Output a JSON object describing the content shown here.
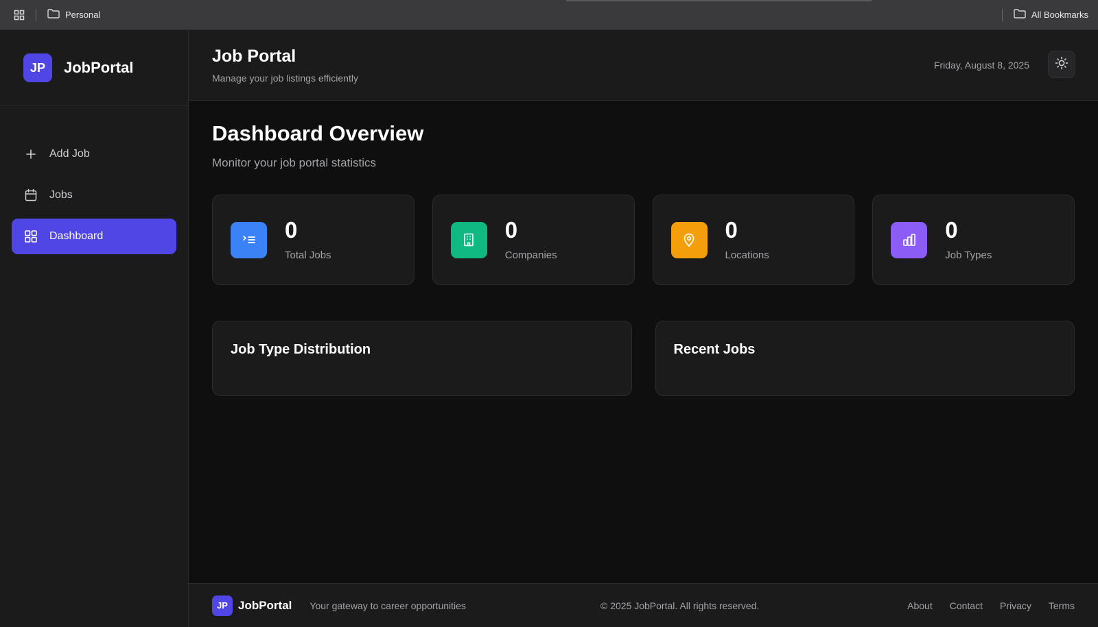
{
  "bookmarks_bar": {
    "apps_icon": "grid-icon",
    "left_folder": "Personal",
    "right_folder": "All Bookmarks"
  },
  "sidebar": {
    "logo_text": "JP",
    "brand": "JobPortal",
    "items": [
      {
        "label": "Add Job",
        "icon": "plus-icon"
      },
      {
        "label": "Jobs",
        "icon": "calendar-icon"
      },
      {
        "label": "Dashboard",
        "icon": "dashboard-grid-icon",
        "active": true
      }
    ]
  },
  "header": {
    "title": "Job Portal",
    "subtitle": "Manage your job listings efficiently",
    "date": "Friday, August 8, 2025",
    "theme_icon": "sun-icon"
  },
  "main": {
    "title": "Dashboard Overview",
    "subtitle": "Monitor your job portal statistics",
    "stats": [
      {
        "value": "0",
        "label": "Total Jobs",
        "icon": "list-icon",
        "color": "#3b82f6"
      },
      {
        "value": "0",
        "label": "Companies",
        "icon": "building-icon",
        "color": "#10b981"
      },
      {
        "value": "0",
        "label": "Locations",
        "icon": "map-pin-icon",
        "color": "#f59e0b"
      },
      {
        "value": "0",
        "label": "Job Types",
        "icon": "bar-chart-icon",
        "color": "#8b5cf6"
      }
    ],
    "panels": [
      {
        "title": "Job Type Distribution"
      },
      {
        "title": "Recent Jobs"
      }
    ]
  },
  "footer": {
    "logo_text": "JP",
    "brand": "JobPortal",
    "tagline": "Your gateway to career opportunities",
    "copyright": "© 2025 JobPortal. All rights reserved.",
    "links": [
      "About",
      "Contact",
      "Privacy",
      "Terms"
    ]
  },
  "colors": {
    "accent": "#4f46e5",
    "background": "#0f0f10",
    "surface": "#1b1b1c"
  }
}
